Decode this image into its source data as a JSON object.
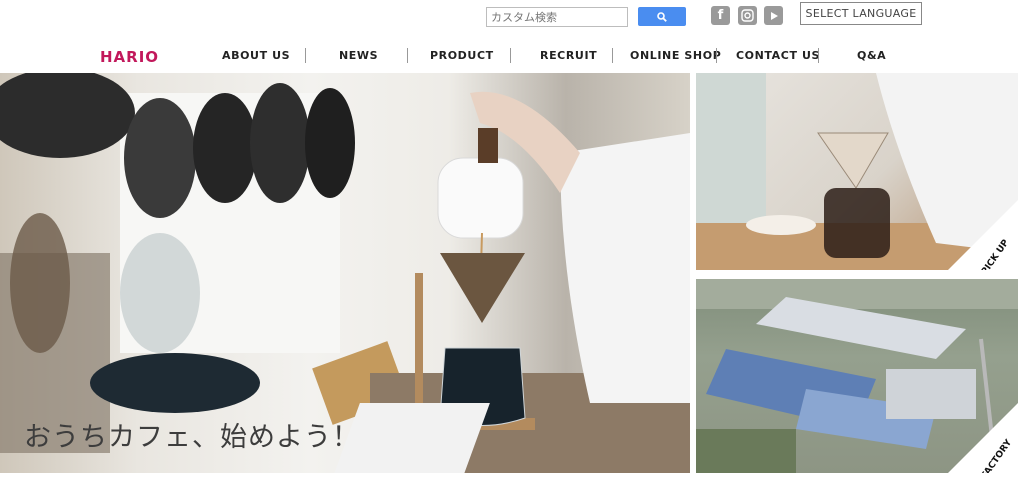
{
  "header": {
    "search": {
      "placeholder": "カスタム検索"
    },
    "social": [
      {
        "icon": "facebook-icon",
        "glyph": "f"
      },
      {
        "icon": "instagram-icon",
        "glyph": "◎"
      },
      {
        "icon": "youtube-icon",
        "glyph": "▶"
      }
    ],
    "language_label": "SELECT LANGUAGE"
  },
  "brand": {
    "logo": "HARIO",
    "color": "#c2185b"
  },
  "nav": {
    "items": [
      "ABOUT US",
      "NEWS",
      "PRODUCT",
      "RECRUIT",
      "ONLINE SHOP",
      "CONTACT US",
      "Q&A"
    ]
  },
  "hero": {
    "caption": "おうちカフェ、始めよう！"
  },
  "tiles": {
    "pickup": {
      "label": "PICK UP"
    },
    "factory": {
      "label": "FACTORY"
    }
  }
}
